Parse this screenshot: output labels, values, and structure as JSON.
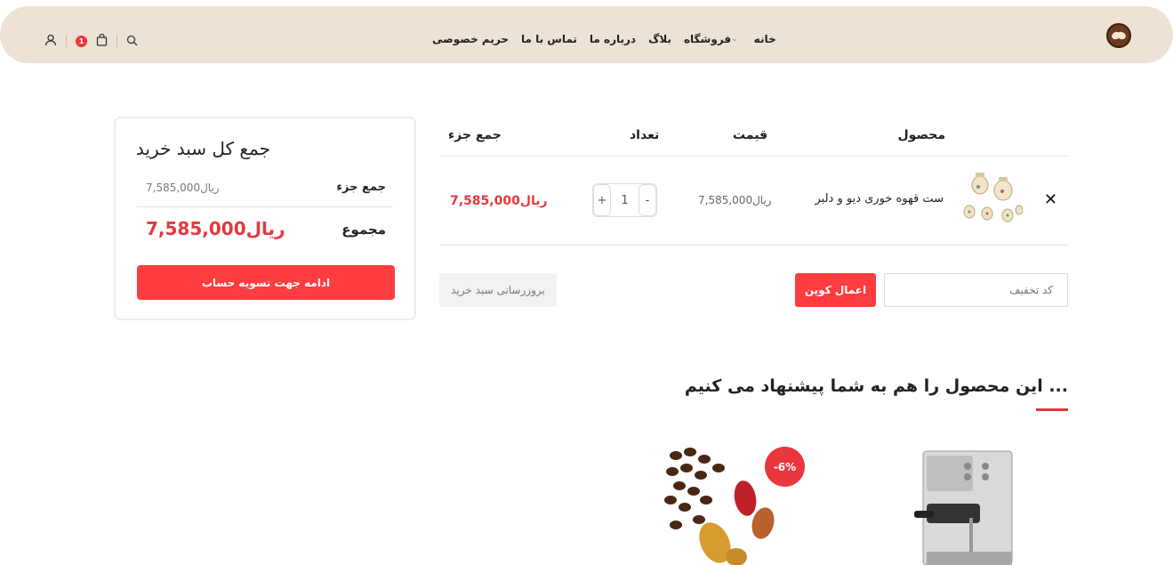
{
  "header": {
    "nav": [
      {
        "label": "خانه"
      },
      {
        "label": "فروشگاه"
      },
      {
        "label": "بلاگ"
      },
      {
        "label": "درباره ما"
      },
      {
        "label": "تماس با ما"
      },
      {
        "label": "حریم خصوصی"
      }
    ],
    "cart_count": "1"
  },
  "cart": {
    "columns": {
      "product": "محصول",
      "price": "قیمت",
      "quantity": "تعداد",
      "subtotal": "جمع جزء"
    },
    "items": [
      {
        "name": "ست قهوه خوری دیو و دلبر",
        "price": "ریال7,585,000",
        "quantity": "1",
        "subtotal": "ریال7,585,000"
      }
    ],
    "coupon_placeholder": "کد تخفیف",
    "apply_coupon": "اعمال کوپن",
    "update_cart": "بروزرسانی سبد خرید"
  },
  "totals": {
    "title": "جمع کل سبد خرید",
    "subtotal_label": "جمع جزء",
    "subtotal_value": "ریال7,585,000",
    "total_label": "مجموع",
    "total_value": "ریال7,585,000",
    "checkout": "ادامه جهت تسویه حساب"
  },
  "suggested": {
    "title": "این محصول را هم به شما پیشنهاد می کنیم ...",
    "badge": "-6%"
  },
  "colors": {
    "accent": "#e8373d",
    "header_bg": "#ece2d6"
  }
}
